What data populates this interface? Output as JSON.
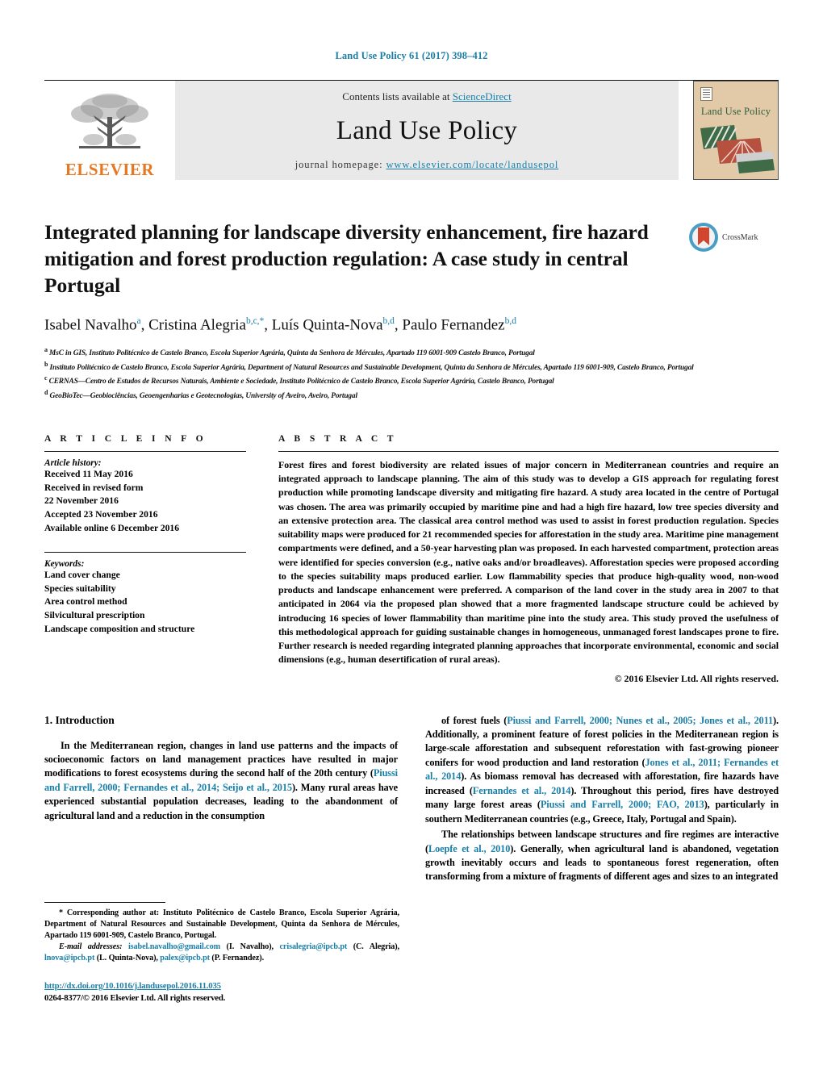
{
  "running_head": "Land Use Policy 61 (2017) 398–412",
  "masthead": {
    "contents_prefix": "Contents lists available at ",
    "sciencedirect": "ScienceDirect",
    "journal_name": "Land Use Policy",
    "homepage_prefix": "journal homepage: ",
    "homepage_url": "www.elsevier.com/locate/landusepol",
    "publisher": "ELSEVIER",
    "cover_title": "Land Use Policy",
    "accent_color": "#1a7fa8",
    "publisher_color": "#E87722"
  },
  "article": {
    "title": "Integrated planning for landscape diversity enhancement, fire hazard mitigation and forest production regulation: A case study in central Portugal",
    "crossmark_label": "CrossMark",
    "authors_html": "Isabel Navalho<sup>a</sup>, Cristina Alegria<sup>b,c,</sup><sup class=\"star\">*</sup>, Luís Quinta-Nova<sup>b,d</sup>, Paulo Fernandez<sup>b,d</sup>",
    "affiliations": [
      {
        "mark": "a",
        "text": "MsC in GIS, Instituto Politécnico de Castelo Branco, Escola Superior Agrária, Quinta da Senhora de Mércules, Apartado 119 6001-909 Castelo Branco, Portugal"
      },
      {
        "mark": "b",
        "text": "Instituto Politécnico de Castelo Branco, Escola Superior Agrária, Department of Natural Resources and Sustainable Development, Quinta da Senhora de Mércules, Apartado 119 6001-909, Castelo Branco, Portugal"
      },
      {
        "mark": "c",
        "text": "CERNAS—Centro de Estudos de Recursos Naturais, Ambiente e Sociedade, Instituto Politécnico de Castelo Branco, Escola Superior Agrária, Castelo Branco, Portugal"
      },
      {
        "mark": "d",
        "text": "GeoBioTec—Geobiociências, Geoengenharias e Geotecnologias, University of Aveiro, Aveiro, Portugal"
      }
    ]
  },
  "article_info": {
    "heading": "A R T I C L E  I N F O",
    "history_label": "Article history:",
    "history": [
      "Received 11 May 2016",
      "Received in revised form",
      "22 November 2016",
      "Accepted 23 November 2016",
      "Available online 6 December 2016"
    ],
    "keywords_label": "Keywords:",
    "keywords": [
      "Land cover change",
      "Species suitability",
      "Area control method",
      "Silvicultural prescription",
      "Landscape composition and structure"
    ]
  },
  "abstract": {
    "heading": "A B S T R A C T",
    "text": "Forest fires and forest biodiversity are related issues of major concern in Mediterranean countries and require an integrated approach to landscape planning. The aim of this study was to develop a GIS approach for regulating forest production while promoting landscape diversity and mitigating fire hazard. A study area located in the centre of Portugal was chosen. The area was primarily occupied by maritime pine and had a high fire hazard, low tree species diversity and an extensive protection area. The classical area control method was used to assist in forest production regulation. Species suitability maps were produced for 21 recommended species for afforestation in the study area. Maritime pine management compartments were defined, and a 50-year harvesting plan was proposed. In each harvested compartment, protection areas were identified for species conversion (e.g., native oaks and/or broadleaves). Afforestation species were proposed according to the species suitability maps produced earlier. Low flammability species that produce high-quality wood, non-wood products and landscape enhancement were preferred. A comparison of the land cover in the study area in 2007 to that anticipated in 2064 via the proposed plan showed that a more fragmented landscape structure could be achieved by introducing 16 species of lower flammability than maritime pine into the study area. This study proved the usefulness of this methodological approach for guiding sustainable changes in homogeneous, unmanaged forest landscapes prone to fire. Further research is needed regarding integrated planning approaches that incorporate environmental, economic and social dimensions (e.g., human desertification of rural areas).",
    "copyright": "© 2016 Elsevier Ltd. All rights reserved."
  },
  "introduction": {
    "section_title": "1.  Introduction",
    "left_para_1_html": "In the Mediterranean region, changes in land use patterns and the impacts of socioeconomic factors on land management practices have resulted in major modifications to forest ecosystems during the second half of the 20th century (<span class=\"ref\">Piussi and Farrell, 2000; Fernandes et al., 2014; Seijo et al., 2015</span>). Many rural areas have experienced substantial population decreases, leading to the abandonment of agricultural land and a reduction in the consumption",
    "right_para_1_html": "of forest fuels (<span class=\"ref\">Piussi and Farrell, 2000; Nunes et al., 2005; Jones et al., 2011</span>). Additionally, a prominent feature of forest policies in the Mediterranean region is large-scale afforestation and subsequent reforestation with fast-growing pioneer conifers for wood production and land restoration (<span class=\"ref\">Jones et al., 2011; Fernandes et al., 2014</span>). As biomass removal has decreased with afforestation, fire hazards have increased (<span class=\"ref\">Fernandes et al., 2014</span>). Throughout this period, fires have destroyed many large forest areas (<span class=\"ref\">Piussi and Farrell, 2000; FAO, 2013</span>), particularly in southern Mediterranean countries (e.g., Greece, Italy, Portugal and Spain).",
    "right_para_2_html": "The relationships between landscape structures and fire regimes are interactive (<span class=\"ref\">Loepfe et al., 2010</span>). Generally, when agricultural land is abandoned, vegetation growth inevitably occurs and leads to spontaneous forest regeneration, often transforming from a mixture of fragments of different ages and sizes to an integrated"
  },
  "footnote": {
    "corresponding_html": "<span class=\"lead\">*  Corresponding author at: Instituto Politécnico de Castelo Branco, Escola Superior Agrária, Department of Natural Resources and Sustainable Development, Quinta da Senhora de Mércules, Apartado 119 6001-909, Castelo Branco, Portugal.</span>",
    "emails_html": "<span class=\"lead\"><em>E-mail addresses:</em> <span class=\"mail\">isabel.navalho@gmail.com</span> (I. Navalho), <span class=\"mail\">crisalegria@ipcb.pt</span> (C. Alegria), <span class=\"mail\">lnova@ipcb.pt</span> (L. Quinta-Nova), <span class=\"mail\">palex@ipcb.pt</span> (P. Fernandez).</span>",
    "doi": "http://dx.doi.org/10.1016/j.landusepol.2016.11.035",
    "issn": "0264-8377/© 2016 Elsevier Ltd. All rights reserved."
  }
}
